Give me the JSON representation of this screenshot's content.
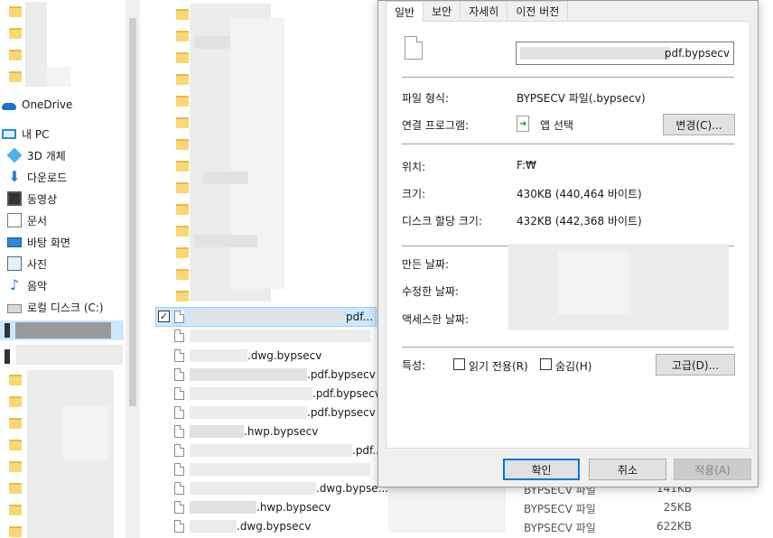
{
  "nav": {
    "onedrive": "OneDrive",
    "mypc": "내 PC",
    "objects3d": "3D 개체",
    "downloads": "다운로드",
    "videos": "동영상",
    "documents": "문서",
    "desktop": "바탕 화면",
    "pictures": "사진",
    "music": "음악",
    "localdisk": "로컬 디스크 (C:)"
  },
  "files": [
    {
      "name": "pdf...",
      "type": "",
      "size": ""
    },
    {
      "name": ".dwg.bypsecv",
      "type": "",
      "size": ""
    },
    {
      "name": ".pdf.bypsecv",
      "type": "",
      "size": ""
    },
    {
      "name": ".pdf.bypsecv",
      "type": "",
      "size": ""
    },
    {
      "name": ".pdf.bypsecv",
      "type": "",
      "size": ""
    },
    {
      "name": ".hwp.bypsecv",
      "type": "",
      "size": ""
    },
    {
      "name": ".pdf...",
      "type": "",
      "size": ""
    },
    {
      "name": ".dwg.bypse...",
      "type": "BYPSECV 파일",
      "size": "141KB"
    },
    {
      "name": ".hwp.bypsecv",
      "type": "BYPSECV 파일",
      "size": "25KB"
    },
    {
      "name": ".dwg.bypsecv",
      "type": "BYPSECV 파일",
      "size": "622KB"
    }
  ],
  "dialog": {
    "tabs": [
      "일반",
      "보안",
      "자세히",
      "이전 버전"
    ],
    "filename": "pdf.bypsecv",
    "file_type_label": "파일 형식:",
    "file_type_value": "BYPSECV 파일(.bypsecv)",
    "opens_with_label": "연결 프로그램:",
    "opens_with_value": "앱 선택",
    "change_button": "변경(C)...",
    "location_label": "위치:",
    "location_value": "F:₩",
    "size_label": "크기:",
    "size_value": "430KB (440,464 바이트)",
    "disk_size_label": "디스크 할당 크기:",
    "disk_size_value": "432KB (442,368 바이트)",
    "created_label": "만든 날짜:",
    "modified_label": "수정한 날짜:",
    "accessed_label": "액세스한 날짜:",
    "attributes_label": "특성:",
    "readonly_label": "읽기 전용(R)",
    "hidden_label": "숨김(H)",
    "advanced_button": "고급(D)...",
    "ok_button": "확인",
    "cancel_button": "취소",
    "apply_button": "적용(A)"
  },
  "colors": {
    "accent": "#0078d7",
    "selection": "#cce8ff",
    "folder": "#f8d775"
  }
}
